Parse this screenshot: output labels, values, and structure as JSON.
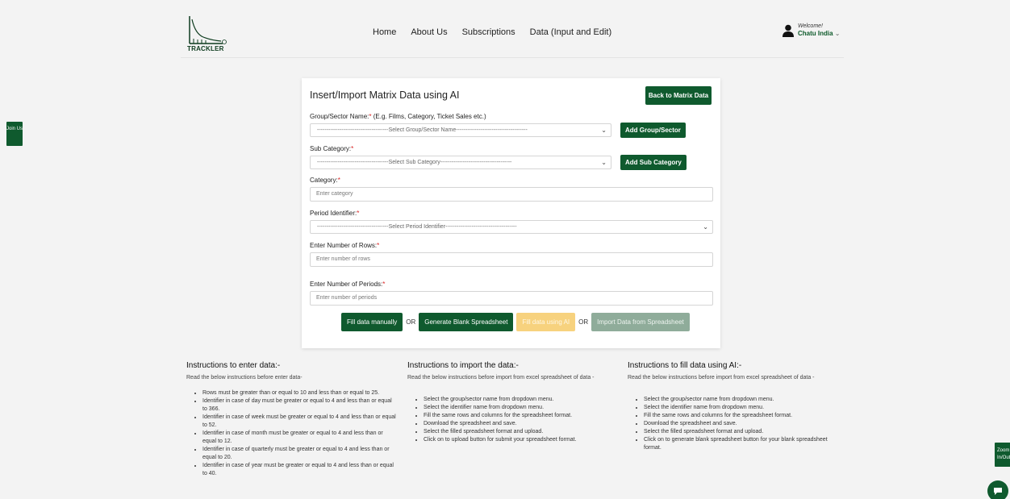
{
  "header": {
    "logo_text": "TRACKLER",
    "nav": [
      "Home",
      "About Us",
      "Subscriptions",
      "Data (Input and Edit)"
    ],
    "welcome": "Welcome!",
    "user_name": "Chatu India"
  },
  "side": {
    "join": "Join Us",
    "zoom": "Zoom In/Out"
  },
  "form": {
    "title": "Insert/Import Matrix Data using AI",
    "back_button": "Back to Matrix Data",
    "group_label": "Group/Sector Name:",
    "group_hint": " (E.g. Films, Category, Ticket Sales etc.)",
    "group_select": "--------------------------------------Select Group/Sector Name--------------------------------------",
    "add_group_button": "Add Group/Sector",
    "sub_label": "Sub Category:",
    "sub_select": "--------------------------------------Select Sub Category--------------------------------------",
    "add_sub_button": "Add Sub Category",
    "category_label": "Category:",
    "category_placeholder": "Enter category",
    "period_label": "Period Identifier:",
    "period_select": "--------------------------------------Select Period Identifier--------------------------------------",
    "rows_label": "Enter Number of Rows:",
    "rows_placeholder": "Enter number of rows",
    "periods_label": "Enter Number of Periods:",
    "periods_placeholder": "Enter number of periods",
    "required_mark": "*",
    "actions": {
      "fill_manually": "Fill data manually",
      "or1": "OR",
      "generate_blank": "Generate Blank Spreadsheet",
      "fill_ai": "Fill data using AI",
      "or2": "OR",
      "import": "Import Data from Spreadsheet"
    }
  },
  "instructions": [
    {
      "title": "Instructions to enter data:-",
      "intro": "Read the below instructions before enter data-",
      "items": [
        "Rows must be greater than or equal to 10 and less than or equal to 25.",
        "Identifier in case of day must be greater or equal to 4 and less than or equal to 366.",
        "Identifier in case of week must be greater or equal to 4 and less than or equal to 52.",
        "Identifier in case of month must be greater or equal to 4 and less than or equal to 12.",
        "Identifier in case of quarterly must be greater or equal to 4 and less than or equal to 20.",
        "Identifier in case of year must be greater or equal to 4 and less than or equal to 40."
      ]
    },
    {
      "title": "Instructions to import the data:-",
      "intro": "Read the below instructions before import from excel spreadsheet of data -",
      "items": [
        "Select the group/sector name from dropdown menu.",
        "Select the identifier name from dropdown menu.",
        "Fill the same rows and columns for the spreadsheet format.",
        "Download the spreadsheet and save.",
        "Select the filled spreadsheet format and upload.",
        "Click on to upload button for submit your spreadsheet format."
      ]
    },
    {
      "title": "Instructions to fill data using AI:-",
      "intro": "Read the below instructions before import from excel spreadsheet of data -",
      "items": [
        "Select the group/sector name from dropdown menu.",
        "Select the identifier name from dropdown menu.",
        "Fill the same rows and columns for the spreadsheet format.",
        "Download the spreadsheet and save.",
        "Select the filled spreadsheet format and upload.",
        "Click on to generate blank spreadsheet button for your blank spreadsheet format."
      ]
    }
  ]
}
